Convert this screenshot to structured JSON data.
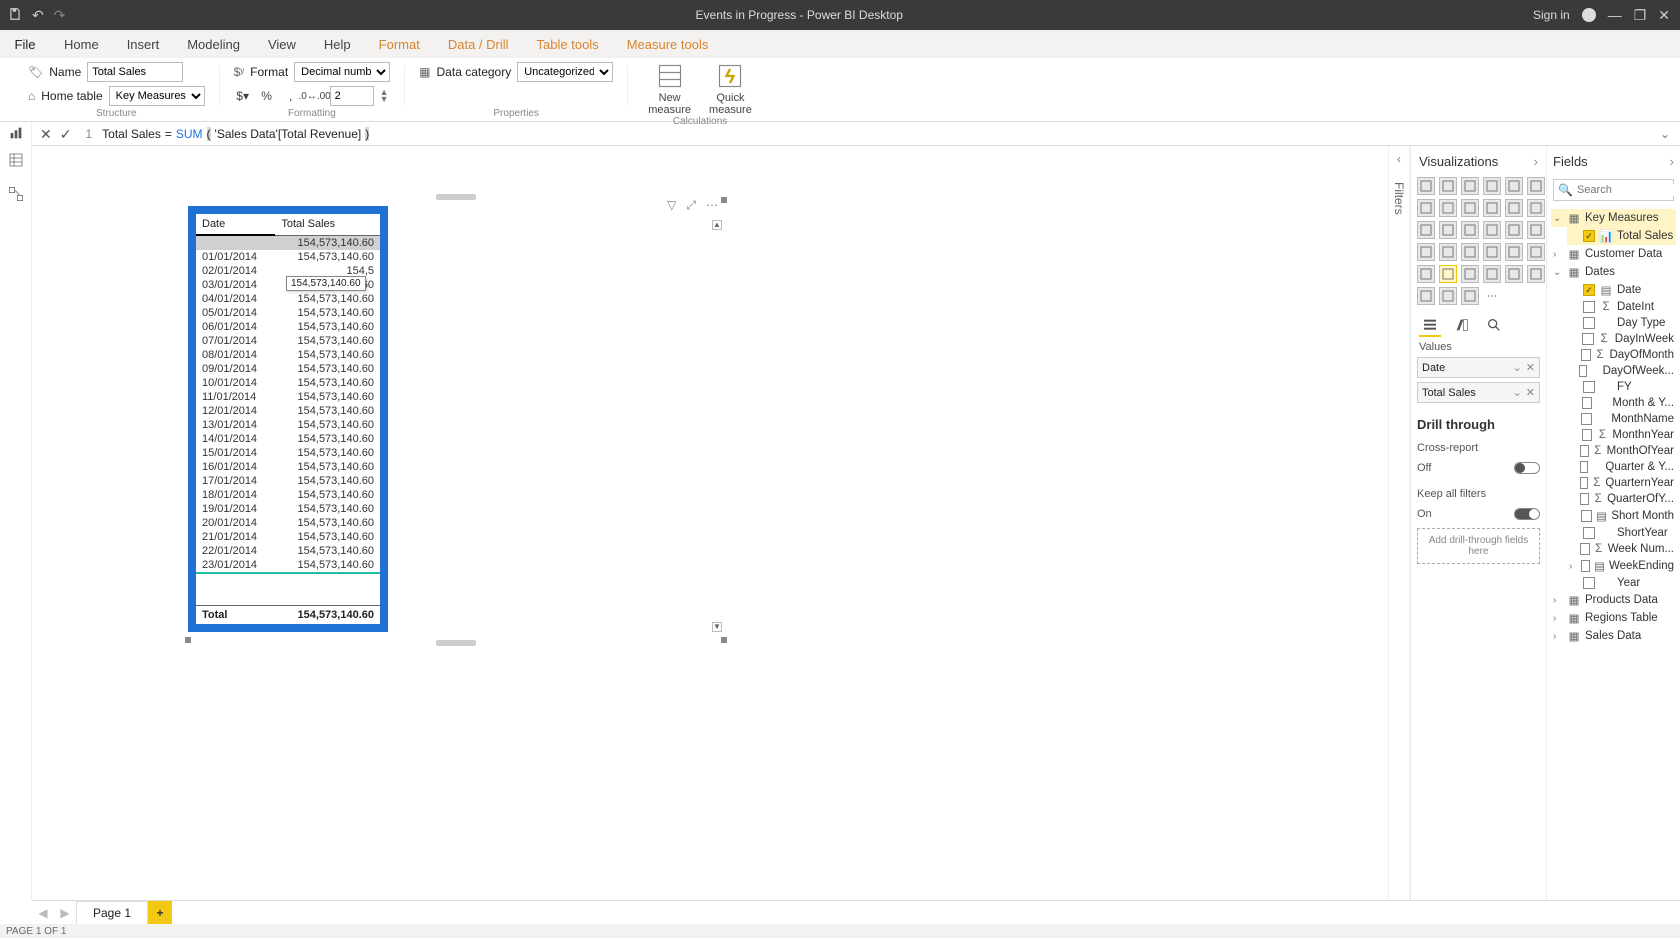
{
  "window": {
    "title": "Events in Progress - Power BI Desktop",
    "signin": "Sign in"
  },
  "ribbon_tabs": {
    "file": "File",
    "items": [
      {
        "label": "Home"
      },
      {
        "label": "Insert"
      },
      {
        "label": "Modeling"
      },
      {
        "label": "View"
      },
      {
        "label": "Help"
      },
      {
        "label": "Format",
        "orange": true
      },
      {
        "label": "Data / Drill",
        "orange": true
      },
      {
        "label": "Table tools",
        "orange": true
      },
      {
        "label": "Measure tools",
        "orange": true,
        "active": true
      }
    ]
  },
  "ribbon": {
    "structure": {
      "name_label": "Name",
      "name_value": "Total Sales",
      "home_table_label": "Home table",
      "home_table_value": "Key Measures",
      "group_label": "Structure"
    },
    "formatting": {
      "format_label": "Format",
      "format_value": "Decimal number",
      "decimals_value": "2",
      "group_label": "Formatting"
    },
    "properties": {
      "data_category_label": "Data category",
      "data_category_value": "Uncategorized",
      "group_label": "Properties"
    },
    "calculations": {
      "new_measure": "New measure",
      "quick_measure": "Quick measure",
      "new_measure_l1": "New",
      "new_measure_l2": "measure",
      "quick_measure_l1": "Quick",
      "quick_measure_l2": "measure",
      "group_label": "Calculations"
    }
  },
  "formula": {
    "line": "1",
    "measure_name": "Total Sales",
    "equals": " = ",
    "fn": "SUM",
    "open": "(",
    "arg": " 'Sales Data'[Total Revenue] ",
    "close": ")"
  },
  "table_visual": {
    "headers": {
      "date": "Date",
      "total_sales": "Total Sales"
    },
    "tooltip": "154,573,140.60",
    "rows": [
      {
        "date": "",
        "value": "154,573,140.60",
        "hl": true
      },
      {
        "date": "01/01/2014",
        "value": "154,573,140.60"
      },
      {
        "date": "02/01/2014",
        "value": "154,5"
      },
      {
        "date": "03/01/2014",
        "value": "154,573,140.60"
      },
      {
        "date": "04/01/2014",
        "value": "154,573,140.60"
      },
      {
        "date": "05/01/2014",
        "value": "154,573,140.60"
      },
      {
        "date": "06/01/2014",
        "value": "154,573,140.60"
      },
      {
        "date": "07/01/2014",
        "value": "154,573,140.60"
      },
      {
        "date": "08/01/2014",
        "value": "154,573,140.60"
      },
      {
        "date": "09/01/2014",
        "value": "154,573,140.60"
      },
      {
        "date": "10/01/2014",
        "value": "154,573,140.60"
      },
      {
        "date": "11/01/2014",
        "value": "154,573,140.60"
      },
      {
        "date": "12/01/2014",
        "value": "154,573,140.60"
      },
      {
        "date": "13/01/2014",
        "value": "154,573,140.60"
      },
      {
        "date": "14/01/2014",
        "value": "154,573,140.60"
      },
      {
        "date": "15/01/2014",
        "value": "154,573,140.60"
      },
      {
        "date": "16/01/2014",
        "value": "154,573,140.60"
      },
      {
        "date": "17/01/2014",
        "value": "154,573,140.60"
      },
      {
        "date": "18/01/2014",
        "value": "154,573,140.60"
      },
      {
        "date": "19/01/2014",
        "value": "154,573,140.60"
      },
      {
        "date": "20/01/2014",
        "value": "154,573,140.60"
      },
      {
        "date": "21/01/2014",
        "value": "154,573,140.60"
      },
      {
        "date": "22/01/2014",
        "value": "154,573,140.60"
      },
      {
        "date": "23/01/2014",
        "value": "154,573,140.60",
        "hl_bot": true
      }
    ],
    "total_label": "Total",
    "total_value": "154,573,140.60"
  },
  "filters_pane": {
    "label": "Filters"
  },
  "visualizations": {
    "title": "Visualizations",
    "values_label": "Values",
    "wells": [
      {
        "label": "Date"
      },
      {
        "label": "Total Sales"
      }
    ],
    "drill_through": "Drill through",
    "cross_report": "Cross-report",
    "off": "Off",
    "keep_all_filters": "Keep all filters",
    "on": "On",
    "drop_hint": "Add drill-through fields here"
  },
  "fields": {
    "title": "Fields",
    "search_placeholder": "Search",
    "tables": [
      {
        "name": "Key Measures",
        "expanded": true,
        "icon": "measure-table",
        "sel": true,
        "children": [
          {
            "name": "Total Sales",
            "checked": true,
            "icon": "measure",
            "sel": true
          }
        ]
      },
      {
        "name": "Customer Data",
        "expanded": false,
        "icon": "table"
      },
      {
        "name": "Dates",
        "expanded": true,
        "icon": "table",
        "children": [
          {
            "name": "Date",
            "checked": true,
            "icon": "hierarchy-date"
          },
          {
            "name": "DateInt",
            "checked": false,
            "icon": "sigma"
          },
          {
            "name": "Day Type",
            "checked": false,
            "icon": ""
          },
          {
            "name": "DayInWeek",
            "checked": false,
            "icon": "sigma"
          },
          {
            "name": "DayOfMonth",
            "checked": false,
            "icon": "sigma"
          },
          {
            "name": "DayOfWeek...",
            "checked": false,
            "icon": ""
          },
          {
            "name": "FY",
            "checked": false,
            "icon": ""
          },
          {
            "name": "Month & Y...",
            "checked": false,
            "icon": ""
          },
          {
            "name": "MonthName",
            "checked": false,
            "icon": ""
          },
          {
            "name": "MonthnYear",
            "checked": false,
            "icon": "sigma"
          },
          {
            "name": "MonthOfYear",
            "checked": false,
            "icon": "sigma"
          },
          {
            "name": "Quarter & Y...",
            "checked": false,
            "icon": ""
          },
          {
            "name": "QuarternYear",
            "checked": false,
            "icon": "sigma"
          },
          {
            "name": "QuarterOfY...",
            "checked": false,
            "icon": "sigma"
          },
          {
            "name": "Short Month",
            "checked": false,
            "icon": "hierarchy"
          },
          {
            "name": "ShortYear",
            "checked": false,
            "icon": ""
          },
          {
            "name": "Week Num...",
            "checked": false,
            "icon": "sigma"
          },
          {
            "name": "WeekEnding",
            "checked": false,
            "icon": "hierarchy",
            "chev": true
          },
          {
            "name": "Year",
            "checked": false,
            "icon": ""
          }
        ]
      },
      {
        "name": "Products Data",
        "expanded": false,
        "icon": "table"
      },
      {
        "name": "Regions Table",
        "expanded": false,
        "icon": "table"
      },
      {
        "name": "Sales Data",
        "expanded": false,
        "icon": "table"
      }
    ]
  },
  "pages": {
    "page1": "Page 1"
  },
  "status": "PAGE 1 OF 1"
}
